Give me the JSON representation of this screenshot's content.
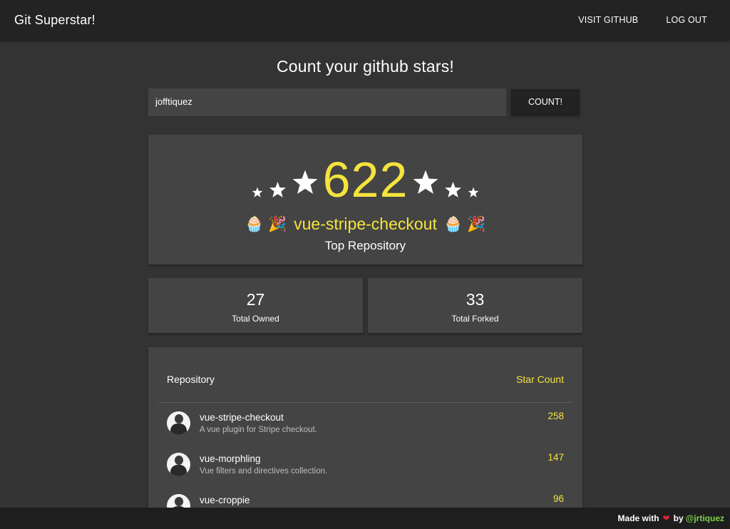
{
  "app": {
    "brand": "Git Superstar!"
  },
  "nav": {
    "items": [
      {
        "label": "Visit Github"
      },
      {
        "label": "Log Out"
      }
    ]
  },
  "page": {
    "title": "Count your github stars!"
  },
  "search": {
    "value": "jofftiquez",
    "button_label": "Count!"
  },
  "summary": {
    "total_stars": "622",
    "top_repo_name": "vue-stripe-checkout",
    "top_repo_label": "Top Repository",
    "emoji_left": [
      "🧁",
      "🎉"
    ],
    "emoji_right": [
      "🧁",
      "🎉"
    ]
  },
  "stats": [
    {
      "value": "27",
      "label": "Total Owned"
    },
    {
      "value": "33",
      "label": "Total Forked"
    }
  ],
  "repo_table": {
    "header_left": "Repository",
    "header_right": "Star Count",
    "rows": [
      {
        "name": "vue-stripe-checkout",
        "description": "A vue plugin for Stripe checkout.",
        "stars": "258"
      },
      {
        "name": "vue-morphling",
        "description": "Vue filters and directives collection.",
        "stars": "147"
      },
      {
        "name": "vue-croppie",
        "description": "",
        "stars": "96"
      }
    ]
  },
  "footer": {
    "prefix": "Made with",
    "by": "by",
    "handle": "@jrtiquez"
  },
  "colors": {
    "accent": "#f5e33e",
    "background": "#333333",
    "card": "#444444",
    "navbar": "#232323",
    "link": "#7bd14a",
    "heart": "#e0233a"
  },
  "icons": {
    "star": "star-icon",
    "heart": "heart-icon",
    "avatar": "user-avatar"
  }
}
